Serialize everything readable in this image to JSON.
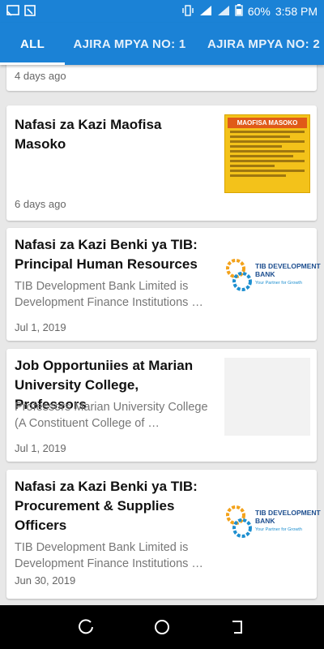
{
  "status_bar": {
    "battery_percent": "60%",
    "time": "3:58 PM"
  },
  "tabs": [
    {
      "label": "ALL"
    },
    {
      "label": "AJIRA MPYA NO: 1"
    },
    {
      "label": "AJIRA MPYA NO: 2"
    }
  ],
  "cards": [
    {
      "date": "4 days ago"
    },
    {
      "title": "Nafasi za Kazi Maofisa Masoko",
      "date": "6 days ago",
      "thumb_heading": "MAOFISA MASOKO"
    },
    {
      "title": "Nafasi za Kazi Benki ya TIB: Principal Human Resources",
      "excerpt": "TIB Development Bank Limited is Development Finance Institutions …",
      "date": "Jul 1, 2019",
      "logo_line1": "TIB DEVELOPMENT",
      "logo_line2": "BANK",
      "logo_tagline": "Your Partner for Growth"
    },
    {
      "title": "Job Opportuniies at Marian University College, Professors",
      "excerpt": "Professors Marian University College (A Constituent College of …",
      "date": "Jul 1, 2019"
    },
    {
      "title": "Nafasi za Kazi Benki ya TIB: Procurement & Supplies Officers",
      "excerpt": "TIB Development Bank Limited is Development Finance Institutions …",
      "date": "Jun 30, 2019",
      "logo_line1": "TIB DEVELOPMENT",
      "logo_line2": "BANK",
      "logo_tagline": "Your Partner for Growth"
    }
  ],
  "colors": {
    "app_bar": "#1b82d6",
    "background": "#e8e8e8",
    "card": "#ffffff"
  }
}
